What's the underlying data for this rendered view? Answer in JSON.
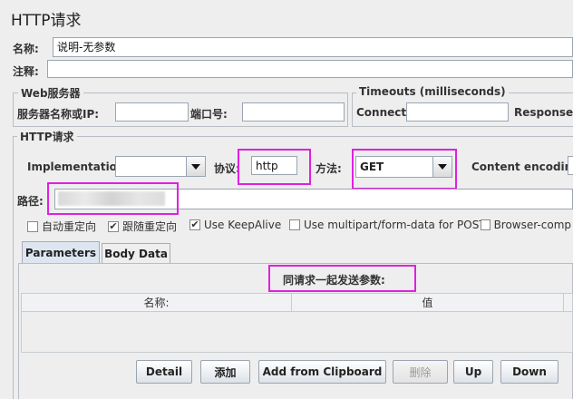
{
  "panel_title": "HTTP请求",
  "name_label": "名称:",
  "name_value": "说明-无参数",
  "comment_label": "注释:",
  "comment_value": "",
  "web_server": {
    "title": "Web服务器",
    "server_label": "服务器名称或IP:",
    "server_value": "",
    "port_label": "端口号:",
    "port_value": ""
  },
  "timeouts": {
    "title": "Timeouts (milliseconds)",
    "connect_label": "Connect:",
    "connect_value": "",
    "response_label": "Response:"
  },
  "http_request": {
    "title": "HTTP请求",
    "implementation_label": "Implementation:",
    "implementation_value": "",
    "protocol_label": "协议:",
    "protocol_value": "http",
    "method_label": "方法:",
    "method_value": "GET",
    "encoding_label": "Content encoding:",
    "path_label": "路径:",
    "path_value": ""
  },
  "checkboxes": [
    {
      "label": "自动重定向",
      "checked": false
    },
    {
      "label": "跟随重定向",
      "checked": true
    },
    {
      "label": "Use KeepAlive",
      "checked": true
    },
    {
      "label": "Use multipart/form-data for POST",
      "checked": false
    },
    {
      "label": "Browser-comp",
      "checked": false
    }
  ],
  "tabs": [
    "Parameters",
    "Body Data"
  ],
  "params_caption": "同请求一起发送参数:",
  "table_headers": [
    "名称:",
    "值"
  ],
  "buttons": {
    "detail": "Detail",
    "add": "添加",
    "clipboard": "Add from Clipboard",
    "delete": "删除",
    "up": "Up",
    "down": "Down"
  },
  "colors": {
    "highlight": "#e020e0",
    "background": "#eeeeee"
  },
  "icons": {
    "dropdown": "chevron-down-icon",
    "check": "check-icon"
  }
}
